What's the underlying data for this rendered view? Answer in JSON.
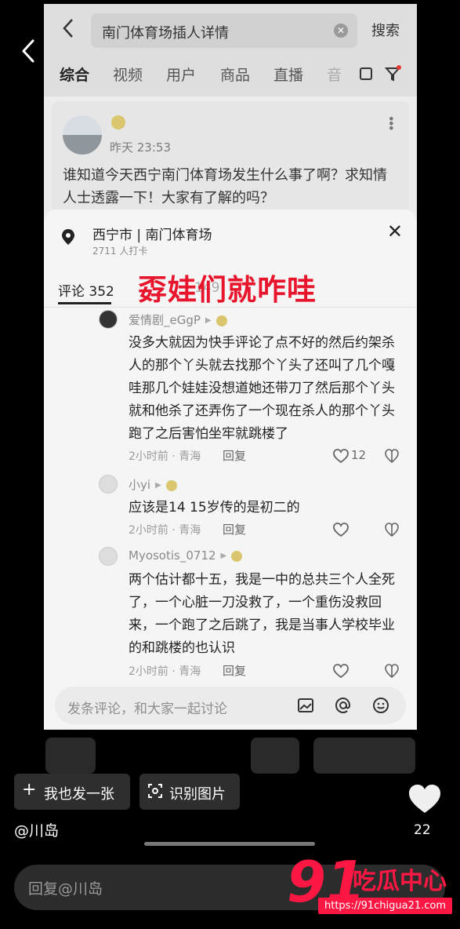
{
  "search": {
    "query": "南门体育场插人详情",
    "button": "搜索"
  },
  "tabs": [
    "综合",
    "视频",
    "用户",
    "商品",
    "直播",
    "音"
  ],
  "post": {
    "time": "昨天 23:53",
    "text": "谁知道今天西宁南门体育场发生什么事了啊？求知情人士透露一下！大家有了解的吗？"
  },
  "location": {
    "title": "西宁市 | 南门体育场",
    "checkins": "2711 人打卡"
  },
  "sheet_tabs": {
    "comments": "评论 352",
    "other": "149"
  },
  "overlay_caption": "孬娃们就咋哇",
  "comments": [
    {
      "user": "爱情剧_eGgP",
      "text": "没多大就因为快手评论了点不好的然后约架杀人的那个丫头就去找那个丫头了还叫了几个嘎哇那几个娃娃没想道她还带刀了然后那个丫头就和他杀了还弄伤了一个现在杀人的那个丫头跑了之后害怕坐牢就跳楼了",
      "meta": "2小时前 · 青海",
      "reply": "回复",
      "likes": "12"
    },
    {
      "user": "小yi",
      "text": "应该是14 15岁传的是初二的",
      "meta": "2小时前 · 青海",
      "reply": "回复",
      "likes": ""
    },
    {
      "user": "Myosotis_0712",
      "text": "两个估计都十五，我是一中的总共三个人全死了，一个心脏一刀没救了，一个重伤没救回来，一个跑了之后跳了，我是当事人学校毕业的和跳楼的也认识",
      "meta": "2小时前 · 青海",
      "reply": "回复",
      "likes": ""
    }
  ],
  "comment_input": "发条评论，和大家一起讨论",
  "actions": {
    "post_one": "我也发一张",
    "recognize": "识别图片"
  },
  "author": "@川岛",
  "like_count": "22",
  "reply_placeholder": "回复@川岛",
  "watermark": {
    "number": "91",
    "text": "吃瓜中心",
    "url": "https://91chigua21.com"
  }
}
